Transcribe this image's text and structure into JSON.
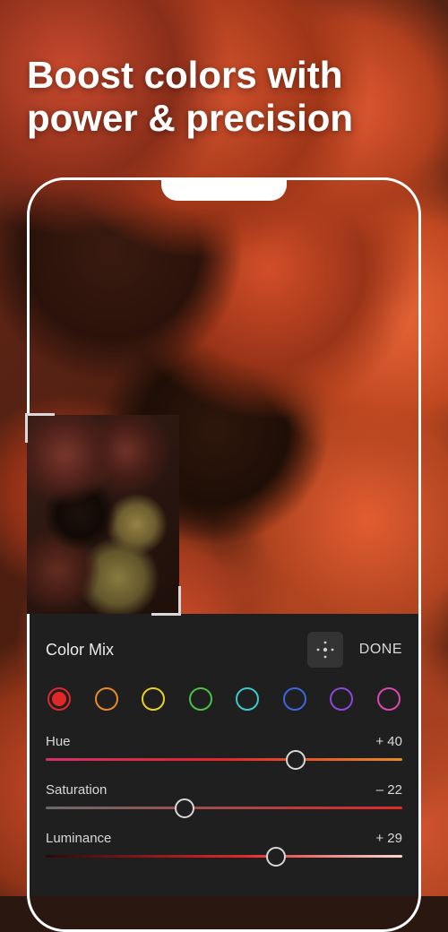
{
  "headline": "Boost colors with power & precision",
  "panel": {
    "title": "Color Mix",
    "done_label": "DONE"
  },
  "swatches": [
    {
      "name": "red",
      "color": "#e02828",
      "selected": true
    },
    {
      "name": "orange",
      "color": "#e88a28",
      "selected": false
    },
    {
      "name": "yellow",
      "color": "#e8d028",
      "selected": false
    },
    {
      "name": "green",
      "color": "#4ac048",
      "selected": false
    },
    {
      "name": "aqua",
      "color": "#3ac8c8",
      "selected": false
    },
    {
      "name": "blue",
      "color": "#3a68e0",
      "selected": false
    },
    {
      "name": "purple",
      "color": "#8a48d8",
      "selected": false
    },
    {
      "name": "magenta",
      "color": "#d848b0",
      "selected": false
    }
  ],
  "sliders": {
    "hue": {
      "label": "Hue",
      "value": "+ 40",
      "position": 70
    },
    "saturation": {
      "label": "Saturation",
      "value": "– 22",
      "position": 39
    },
    "luminance": {
      "label": "Luminance",
      "value": "+ 29",
      "position": 64.5
    }
  }
}
